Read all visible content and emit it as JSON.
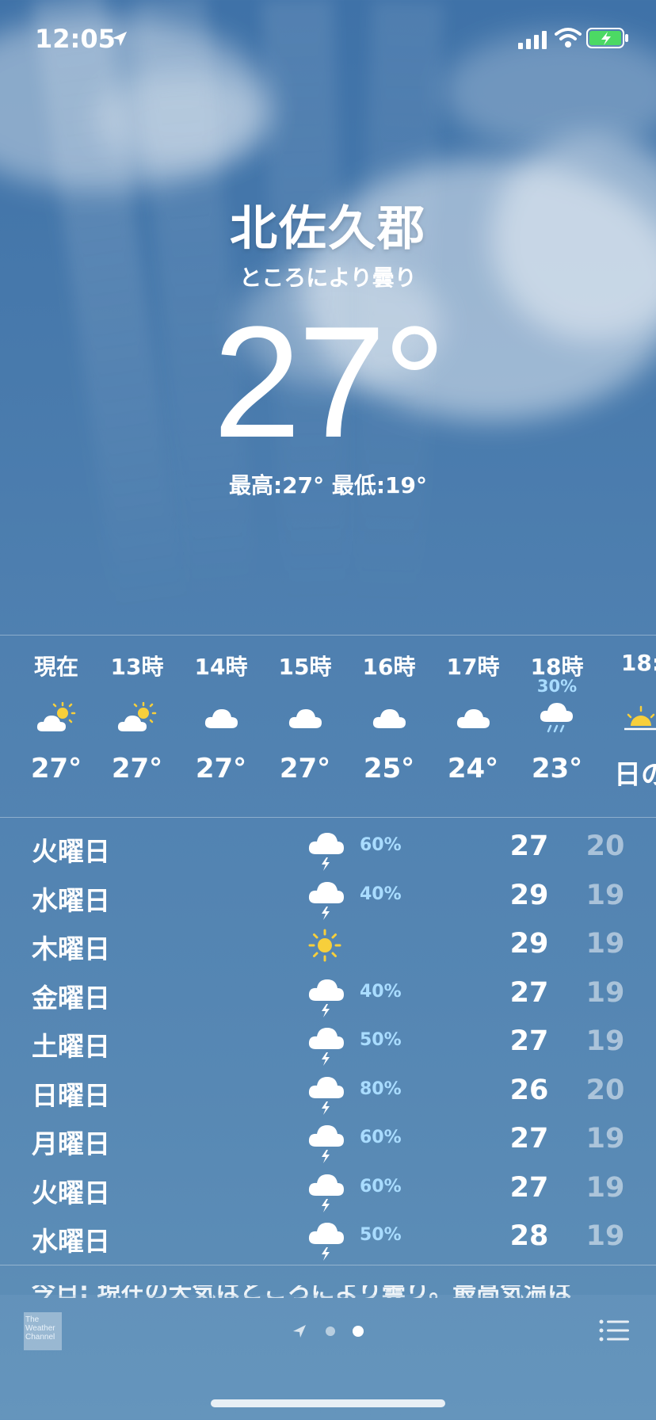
{
  "status_bar": {
    "time": "12:05"
  },
  "header": {
    "city": "北佐久郡",
    "condition": "ところにより曇り",
    "temperature": "27°",
    "hilo": "最高:27° 最低:19°"
  },
  "hourly": [
    {
      "label": "現在",
      "pop": "",
      "icon": "partly-cloudy-icon",
      "temp": "27°"
    },
    {
      "label": "13時",
      "pop": "",
      "icon": "partly-cloudy-icon",
      "temp": "27°"
    },
    {
      "label": "14時",
      "pop": "",
      "icon": "cloud-icon",
      "temp": "27°"
    },
    {
      "label": "15時",
      "pop": "",
      "icon": "cloud-icon",
      "temp": "27°"
    },
    {
      "label": "16時",
      "pop": "",
      "icon": "cloud-icon",
      "temp": "25°"
    },
    {
      "label": "17時",
      "pop": "",
      "icon": "cloud-icon",
      "temp": "24°"
    },
    {
      "label": "18時",
      "pop": "30%",
      "icon": "rain-cloud-icon",
      "temp": "23°"
    },
    {
      "label": "18:",
      "pop": "",
      "icon": "sunset-icon",
      "temp": "日の"
    }
  ],
  "daily": [
    {
      "name": "火曜日",
      "icon": "thunderstorm-icon",
      "pop": "60%",
      "hi": "27",
      "lo": "20"
    },
    {
      "name": "水曜日",
      "icon": "thunderstorm-icon",
      "pop": "40%",
      "hi": "29",
      "lo": "19"
    },
    {
      "name": "木曜日",
      "icon": "sun-icon",
      "pop": "",
      "hi": "29",
      "lo": "19"
    },
    {
      "name": "金曜日",
      "icon": "thunderstorm-icon",
      "pop": "40%",
      "hi": "27",
      "lo": "19"
    },
    {
      "name": "土曜日",
      "icon": "thunderstorm-icon",
      "pop": "50%",
      "hi": "27",
      "lo": "19"
    },
    {
      "name": "日曜日",
      "icon": "thunderstorm-icon",
      "pop": "80%",
      "hi": "26",
      "lo": "20"
    },
    {
      "name": "月曜日",
      "icon": "thunderstorm-icon",
      "pop": "60%",
      "hi": "27",
      "lo": "19"
    },
    {
      "name": "火曜日",
      "icon": "thunderstorm-icon",
      "pop": "60%",
      "hi": "27",
      "lo": "19"
    },
    {
      "name": "水曜日",
      "icon": "thunderstorm-icon",
      "pop": "50%",
      "hi": "28",
      "lo": "19"
    }
  ],
  "summary": "今日: 現在の天気はところにより曇り。最高気温は",
  "footer": {
    "brand": "The Weather Channel"
  },
  "colors": {
    "pop": "#a9dcff",
    "sun": "#f7cf3b",
    "sky": "#4678ab"
  }
}
